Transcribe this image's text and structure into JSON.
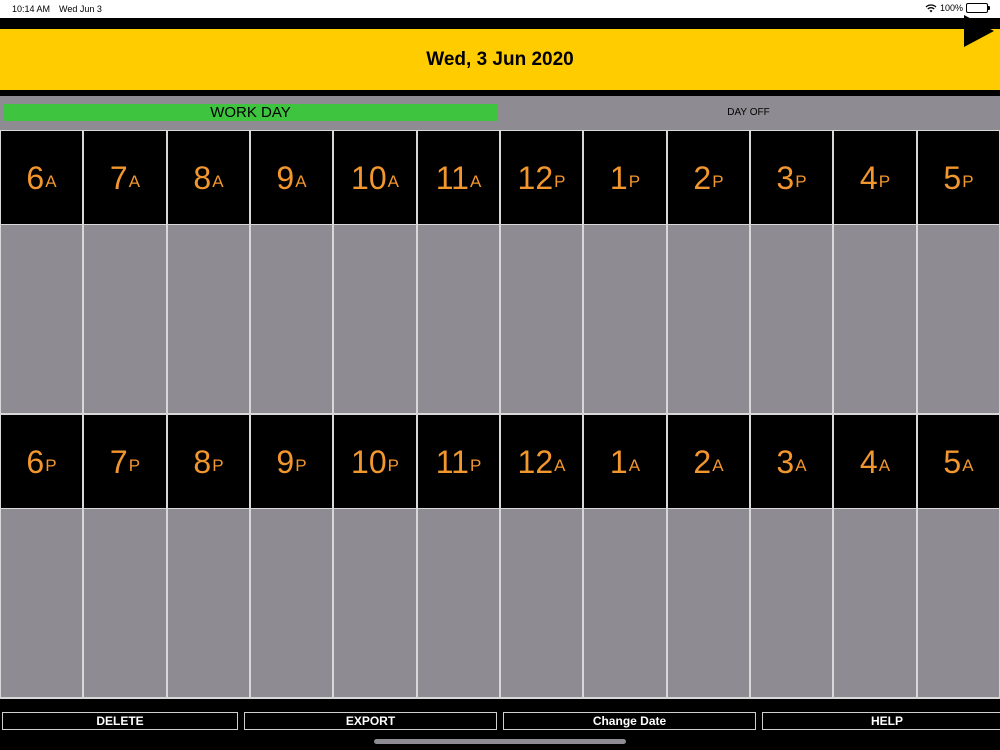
{
  "status_bar": {
    "time": "10:14 AM",
    "date": "Wed Jun 3",
    "battery": "100%"
  },
  "header": {
    "title": "Wed, 3 Jun 2020",
    "next_icon": "play-triangle-icon"
  },
  "day_type": {
    "work_label": "WORK DAY",
    "off_label": "DAY OFF",
    "selected": "WORK DAY",
    "work_color": "#3ec43e"
  },
  "colors": {
    "header_bg": "#ffcc00",
    "hour_text": "#f2962e",
    "slot_bg": "#8e8c92"
  },
  "rows": [
    {
      "hours": [
        {
          "n": "6",
          "ap": "A"
        },
        {
          "n": "7",
          "ap": "A"
        },
        {
          "n": "8",
          "ap": "A"
        },
        {
          "n": "9",
          "ap": "A"
        },
        {
          "n": "10",
          "ap": "A"
        },
        {
          "n": "11",
          "ap": "A"
        },
        {
          "n": "12",
          "ap": "P"
        },
        {
          "n": "1",
          "ap": "P"
        },
        {
          "n": "2",
          "ap": "P"
        },
        {
          "n": "3",
          "ap": "P"
        },
        {
          "n": "4",
          "ap": "P"
        },
        {
          "n": "5",
          "ap": "P"
        }
      ]
    },
    {
      "hours": [
        {
          "n": "6",
          "ap": "P"
        },
        {
          "n": "7",
          "ap": "P"
        },
        {
          "n": "8",
          "ap": "P"
        },
        {
          "n": "9",
          "ap": "P"
        },
        {
          "n": "10",
          "ap": "P"
        },
        {
          "n": "11",
          "ap": "P"
        },
        {
          "n": "12",
          "ap": "A"
        },
        {
          "n": "1",
          "ap": "A"
        },
        {
          "n": "2",
          "ap": "A"
        },
        {
          "n": "3",
          "ap": "A"
        },
        {
          "n": "4",
          "ap": "A"
        },
        {
          "n": "5",
          "ap": "A"
        }
      ]
    }
  ],
  "toolbar": {
    "delete": "DELETE",
    "export": "EXPORT",
    "change_date": "Change Date",
    "help": "HELP"
  }
}
